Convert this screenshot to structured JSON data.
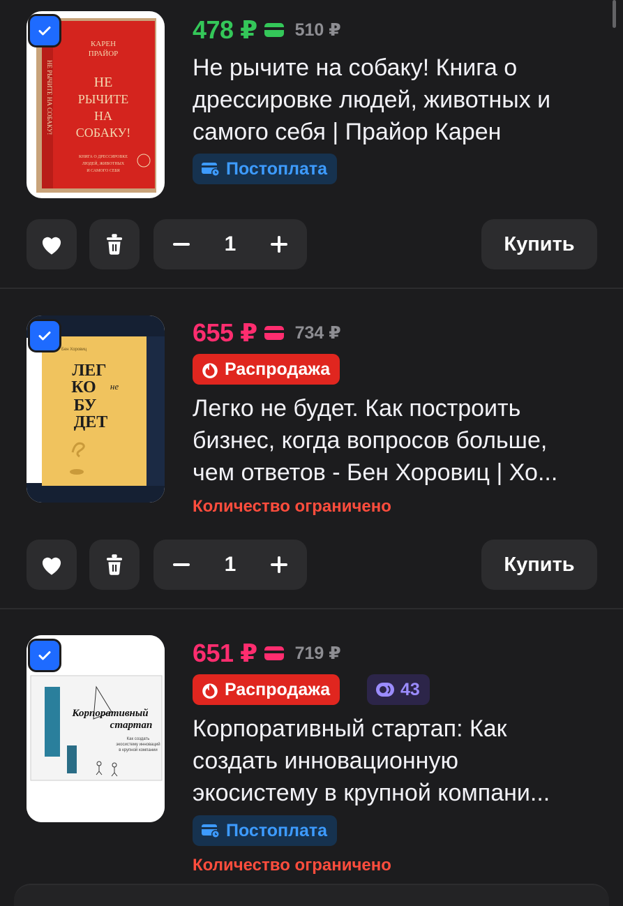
{
  "items": [
    {
      "price": "478 ₽",
      "old_price": "510 ₽",
      "price_color": "#34c759",
      "title_lines": [
        "Не рычите на собаку! Книга о",
        "дрессировке людей, животных и",
        "самого себя | Прайор Карен"
      ],
      "badge_post": "Постоплата",
      "cover": {
        "author": "КАРЕН\nПРАЙОР",
        "title": "НЕ\nРЫЧИТЕ\nНА\nСОБАКУ!",
        "sub": "КНИГА О ДРЕССИРОВКЕ ЛЮДЕЙ, ЖИВОТНЫХ И САМОГО СЕБЯ",
        "spine": "НЕ РЫЧИТЕ НА СОБАКУ!"
      },
      "quantity": "1",
      "buy_label": "Купить"
    },
    {
      "price": "655 ₽",
      "old_price": "734 ₽",
      "price_color": "#ff2d6f",
      "badge_sale": "Распродажа",
      "title_lines": [
        "Легко не будет. Как построить",
        "бизнес, когда вопросов больше,",
        "чем ответов - Бен Хоровиц | Хо..."
      ],
      "limited": "Количество ограничено",
      "cover": {
        "author": "Бен Хоровиц",
        "title": "ЛЕГ\nКО не\nБУ\nДЕТ"
      },
      "quantity": "1",
      "buy_label": "Купить"
    },
    {
      "price": "651 ₽",
      "old_price": "719 ₽",
      "price_color": "#ff2d6f",
      "badge_sale": "Распродажа",
      "badge_count": "43",
      "title_lines": [
        "Корпоративный стартап: Как",
        "создать инновационную",
        "экосистему в крупной компани..."
      ],
      "badge_post": "Постоплата",
      "limited": "Количество ограничено",
      "cover": {
        "title": "Корпоративный\nстартап",
        "sub": "Как создать экосистему инноваций в крупной компании"
      }
    }
  ],
  "colors": {
    "accent": "#1e6bff",
    "sale": "#e0261f",
    "postpay": "#3d9bff",
    "limited": "#ff4d3d"
  },
  "icons": [
    "check-icon",
    "card-icon",
    "heart-icon",
    "trash-icon",
    "minus-icon",
    "plus-icon",
    "fire-icon",
    "coin-icon"
  ]
}
